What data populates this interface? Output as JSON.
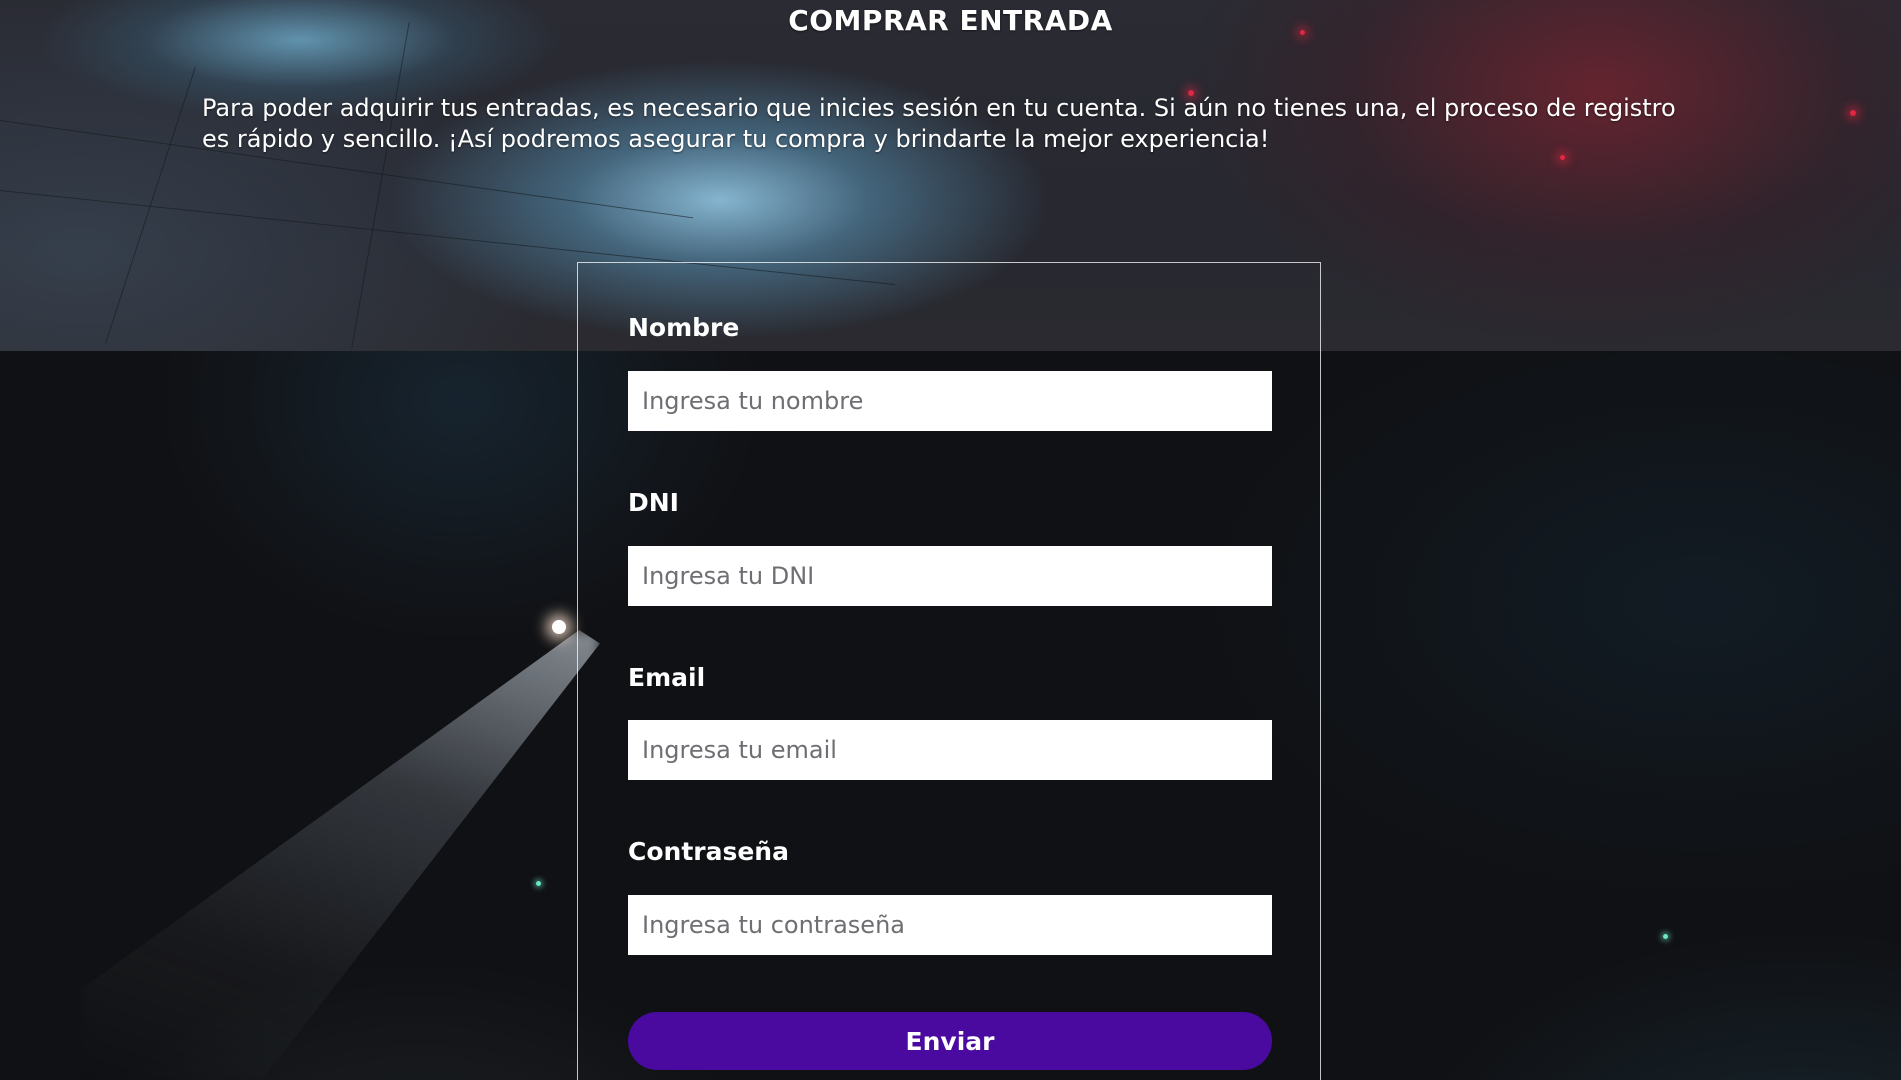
{
  "header": {
    "title": "COMPRAR ENTRADA",
    "intro": "Para poder adquirir tus entradas, es necesario que inicies sesión en tu cuenta. Si aún no tienes una, el proceso de registro es rápido y sencillo. ¡Así podremos asegurar tu compra y brindarte la mejor experiencia!"
  },
  "form": {
    "fields": [
      {
        "label": "Nombre",
        "placeholder": "Ingresa tu nombre",
        "value": ""
      },
      {
        "label": "DNI",
        "placeholder": "Ingresa tu DNI",
        "value": ""
      },
      {
        "label": "Email",
        "placeholder": "Ingresa tu email",
        "value": ""
      },
      {
        "label": "Contraseña",
        "placeholder": "Ingresa tu contraseña",
        "value": ""
      }
    ],
    "submit_label": "Enviar"
  },
  "colors": {
    "button": "#4a0aa0",
    "background": "#101114",
    "text": "#ffffff"
  }
}
